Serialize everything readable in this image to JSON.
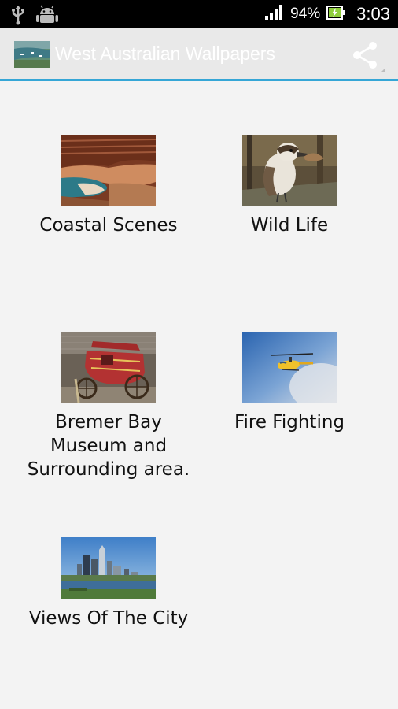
{
  "status_bar": {
    "battery_percent": "94%",
    "time": "3:03",
    "icons": [
      "usb-icon",
      "android-debug-icon",
      "signal-icon",
      "battery-charging-icon"
    ]
  },
  "action_bar": {
    "title": "West Australian Wallpapers",
    "icons": [
      "app-icon",
      "share-icon"
    ],
    "accent_color": "#35a6d6"
  },
  "grid": {
    "items": [
      {
        "label": "Coastal Scenes"
      },
      {
        "label": "Wild Life"
      },
      {
        "label": "Bremer Bay\nMuseum and\nSurrounding area."
      },
      {
        "label": "Fire Fighting"
      },
      {
        "label": "Views Of The City"
      }
    ]
  }
}
